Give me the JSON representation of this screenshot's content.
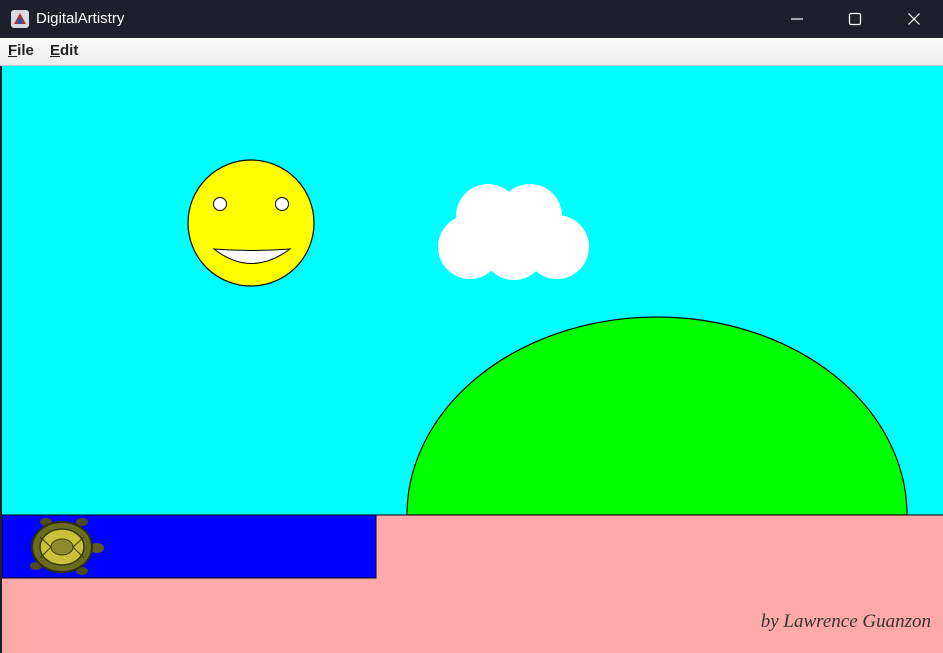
{
  "window": {
    "title": "DigitalArtistry",
    "controls": [
      "minimize-icon",
      "maximize-icon",
      "close-icon"
    ]
  },
  "menu": {
    "items": [
      {
        "label": "File"
      },
      {
        "label": "Edit"
      }
    ]
  },
  "canvas": {
    "colors": {
      "sky": "#00ffff",
      "sun": "#ffff00",
      "cloud": "#ffffff",
      "hill": "#00ff00",
      "water": "#0000ff",
      "ground": "#ffaaaa"
    },
    "signature": "by Lawrence Guanzon"
  }
}
